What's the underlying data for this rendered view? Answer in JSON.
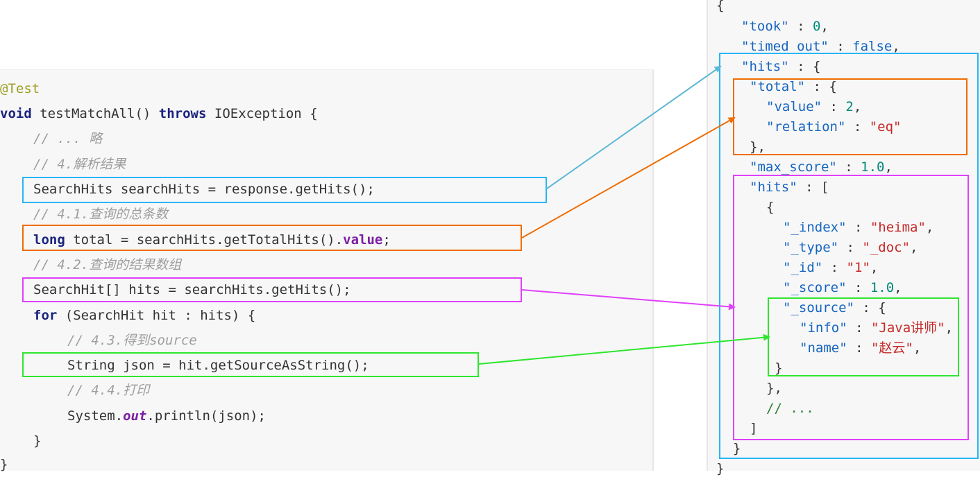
{
  "code": {
    "annotation": "@Test",
    "signature": {
      "kw_void": "void",
      "name": " testMatchAll() ",
      "kw_throws": "throws",
      "rest": " IOException {"
    },
    "c_omit": "// ... 略",
    "c_parse": "// 4.解析结果",
    "l_searchhits": "SearchHits searchHits = response.getHits();",
    "c_total": "// 4.1.查询的总条数",
    "l_total": {
      "kw_long": "long",
      "mid": " total = searchHits.getTotalHits().",
      "kw_value": "value",
      "end": ";"
    },
    "c_array": "// 4.2.查询的结果数组",
    "l_hits": "SearchHit[] hits = searchHits.getHits();",
    "l_for": {
      "kw_for": "for",
      "rest": " (SearchHit hit : hits) {"
    },
    "c_source": "// 4.3.得到source",
    "l_json": "String json = hit.getSourceAsString();",
    "c_print": "// 4.4.打印",
    "l_print": {
      "pre": "System.",
      "kw_out": "out",
      "post": ".println(json);"
    },
    "close_for": "}",
    "close_method": "}"
  },
  "json": {
    "open": "{",
    "took_k": "\"took\"",
    "took_v": "0",
    "timed_k": "\"timed_out\"",
    "timed_v": "false",
    "hits_k": "\"hits\"",
    "total_k": "\"total\"",
    "value_k": "\"value\"",
    "value_v": "2",
    "relation_k": "\"relation\"",
    "relation_v": "\"eq\"",
    "total_close": "},",
    "maxscore_k": "\"max_score\"",
    "maxscore_v": "1.0",
    "hitsarr_k": "\"hits\"",
    "obj_open": "{",
    "index_k": "\"_index\"",
    "index_v": "\"heima\"",
    "type_k": "\"_type\"",
    "type_v": "\"_doc\"",
    "id_k": "\"_id\"",
    "id_v": "\"1\"",
    "score_k": "\"_score\"",
    "score_v": "1.0",
    "source_k": "\"_source\"",
    "info_k": "\"info\"",
    "info_v": "\"Java讲师\"",
    "name_k": "\"name\"",
    "name_v": "\"赵云\"",
    "source_close": "}",
    "obj_close": "},",
    "ellipsis": "// ...",
    "arr_close": "]",
    "hits_close": "}",
    "close": "}"
  },
  "colors": {
    "blue": "#29b6f6",
    "orange": "#ef6c00",
    "magenta": "#e040fb",
    "green": "#2ee62e",
    "arrow_blue": "#5ab8d6"
  }
}
